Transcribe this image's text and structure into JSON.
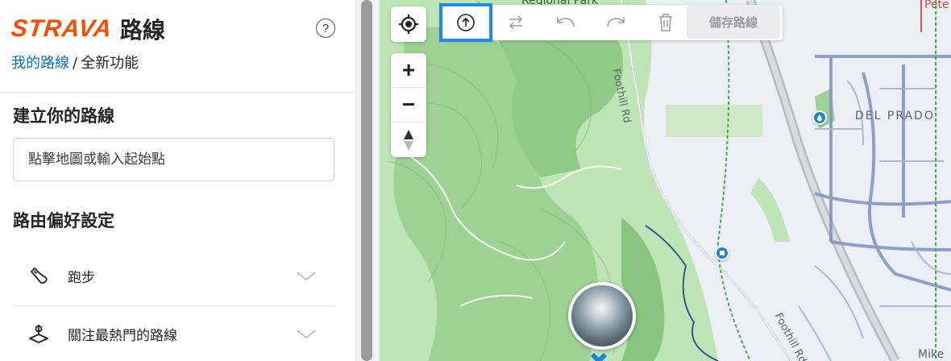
{
  "brand": {
    "logo": "STRAVA",
    "title": "路線"
  },
  "header": {
    "help_icon": "question-circle-icon",
    "help_glyph": "?"
  },
  "breadcrumb": {
    "link": "我的路線",
    "separator": "/",
    "current": "全新功能"
  },
  "build": {
    "heading": "建立你的路線",
    "input_placeholder": "點擊地圖或輸入起始點",
    "input_value": ""
  },
  "preferences": {
    "heading": "路由偏好設定",
    "items": [
      {
        "label": "跑步",
        "icon": "running-shoe-icon"
      },
      {
        "label": "關注最熱門的路線",
        "icon": "heatmap-pin-icon"
      }
    ]
  },
  "map_controls": {
    "locate_icon": "crosshair-icon",
    "zoom_in": "+",
    "zoom_out": "−",
    "compass_icon": "compass-icon"
  },
  "toolbar": {
    "items": [
      {
        "icon": "arrow-up-circle-icon",
        "active": true
      },
      {
        "icon": "swap-direction-icon",
        "active": false
      },
      {
        "icon": "undo-icon",
        "active": false
      },
      {
        "icon": "redo-icon",
        "active": false
      },
      {
        "icon": "trash-icon",
        "active": false
      }
    ],
    "save_label": "儲存路線"
  },
  "map": {
    "labels": {
      "regional_park": "Regional Park",
      "foothill_rd": "Foothill Rd",
      "foothill_rd_lower": "Foothill Rd",
      "del_prado": "DEL PRADO",
      "pete": "Pete",
      "mike": "Mike"
    }
  },
  "colors": {
    "brand": "#fc4c02",
    "link": "#0a6fc4",
    "active_outline": "#1e88f5",
    "route_blue": "#1c83d7"
  }
}
